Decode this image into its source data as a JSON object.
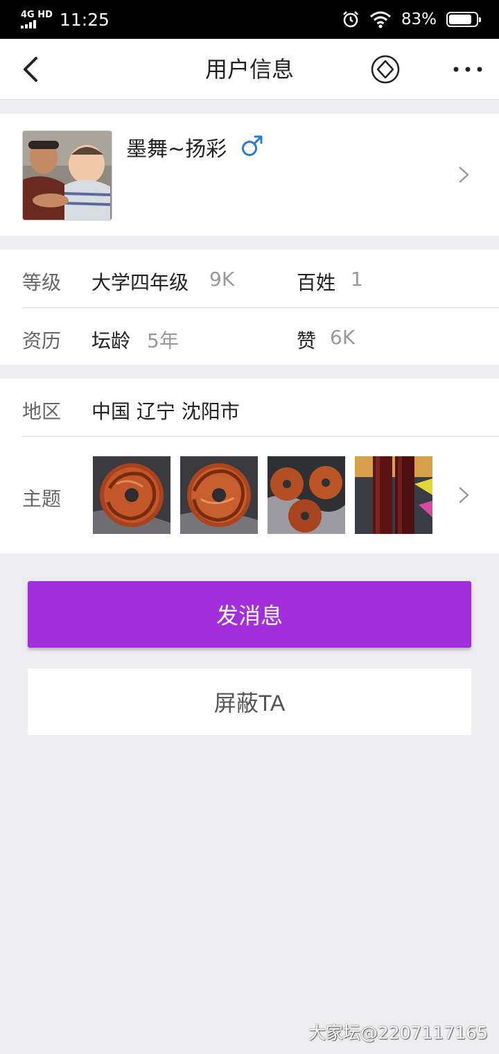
{
  "status_bar": {
    "network": "4G HD",
    "time": "11:25",
    "alarm_icon": "alarm-clock-icon",
    "wifi_icon": "wifi-icon",
    "battery": "83%",
    "battery_level": 0.83
  },
  "nav": {
    "title": "用户信息",
    "back_icon": "chevron-left-icon",
    "diamond_icon": "diamond-icon",
    "more_icon": "more-dots-icon"
  },
  "profile": {
    "username": "墨舞~扬彩",
    "gender_symbol": "♂",
    "gender_color": "#2a7bd1"
  },
  "info": {
    "level_label": "等级",
    "level_value": "大学四年级",
    "level_points": "9K",
    "rank_label": "百姓",
    "rank_value": "1",
    "history_label": "资历",
    "age_label": "坛龄",
    "age_value": "5年",
    "likes_label": "赞",
    "likes_value": "6K"
  },
  "region": {
    "label": "地区",
    "value": "中国 辽宁 沈阳市"
  },
  "topics": {
    "label": "主题",
    "thumbnails": [
      "carved-dragon-disc",
      "carved-dragon-disc",
      "carved-dragon-discs-group",
      "rosewood-chopsticks"
    ]
  },
  "actions": {
    "message_label": "发消息",
    "message_color": "#a32edb",
    "block_label": "屏蔽TA"
  },
  "watermark": "大家坛@2207117165"
}
